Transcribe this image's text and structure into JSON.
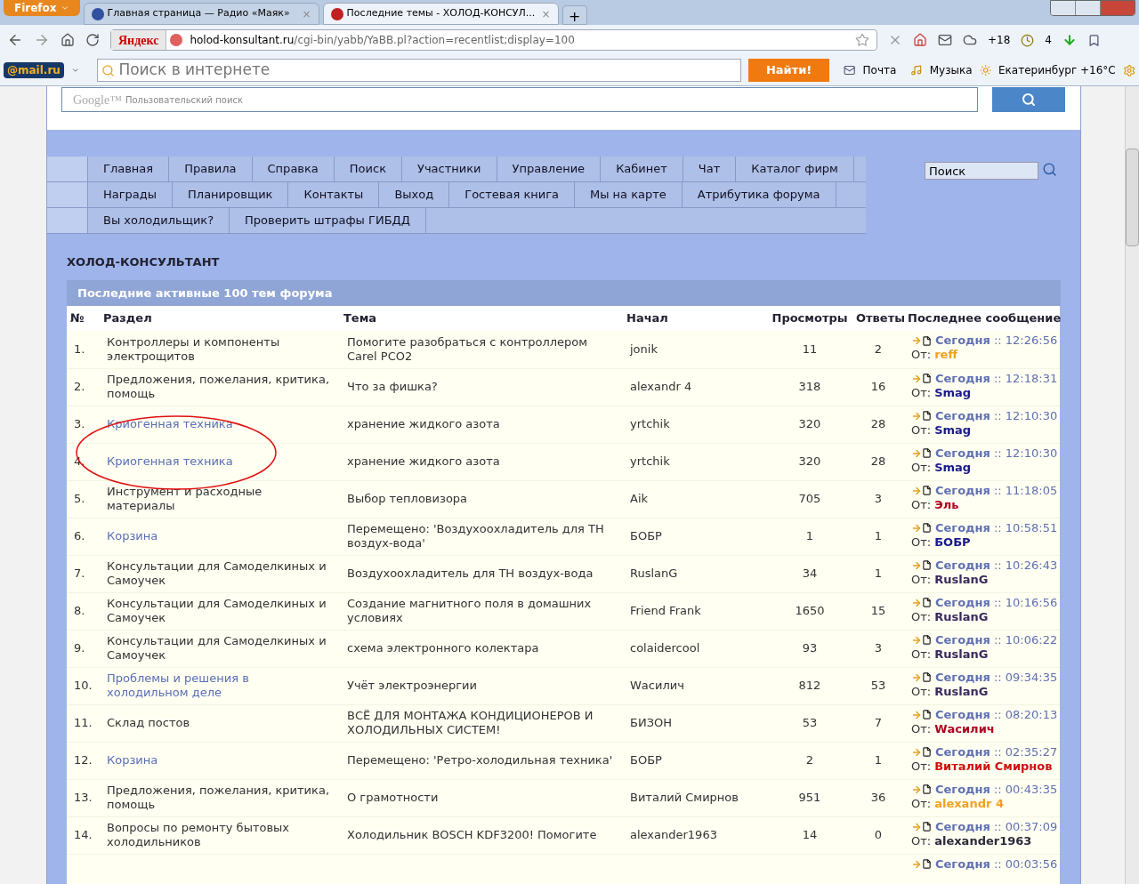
{
  "browser": {
    "menu_button": "Firefox",
    "tabs": [
      {
        "label": "Главная страница — Радио «Маяк»",
        "selected": false,
        "close": "×"
      },
      {
        "label": "Последние темы - ХОЛОД-КОНСУЛ...",
        "selected": true,
        "close": "×"
      }
    ],
    "new_tab": "+",
    "yandex": "Яндекс",
    "url": {
      "domain": "holod-konsultant.ru",
      "path": "/cgi-bin/yabb/YaBB.pl?action=recentlist;display=100"
    },
    "weather_temp": "+18",
    "counter": "4",
    "mail_logo": "@mail.ru",
    "search_placeholder": "Поиск в интернете",
    "search_button": "Найти!",
    "mail_link": "Почта",
    "music_link": "Музыка",
    "city_weather": "Екатеринбург +16°C"
  },
  "page": {
    "google_logo": "Google™",
    "google_placeholder": "Пользовательский поиск",
    "nav_rows": [
      [
        "Главная",
        "Правила",
        "Справка",
        "Поиск",
        "Участники",
        "Управление",
        "Кабинет",
        "Чат",
        "Каталог фирм"
      ],
      [
        "Награды",
        "Планировщик",
        "Контакты",
        "Выход",
        "Гостевая книга",
        "Мы на карте",
        "Атрибутика форума"
      ],
      [
        "Вы холодильщик?",
        "Проверить штрафы ГИБДД"
      ]
    ],
    "nav_search": "Поиск",
    "forum_title": "ХОЛОД-КОНСУЛЬТАНТ",
    "table_title": "Последние активные 100 тем форума",
    "columns": [
      "№",
      "Раздел",
      "Тема",
      "Начал",
      "Просмотры",
      "Ответы",
      "Последнее сообщение"
    ],
    "rows": [
      {
        "num": "1.",
        "section": {
          "text": "Контроллеры и компоненты электрощитов",
          "color": "#333333"
        },
        "topic": "Помогите разобраться с контроллером Carel PCO2",
        "starter": "jonik",
        "views": "11",
        "replies": "2",
        "last": {
          "day": "Сегодня",
          "time": ":: 12:26:56",
          "from_label": "От:",
          "from": "reff",
          "color": "#f0a020"
        }
      },
      {
        "num": "2.",
        "section": {
          "text": "Предложения, пожелания, критика, помощь",
          "color": "#333333"
        },
        "topic": "Что за фишка?",
        "starter": "alexandr 4",
        "views": "318",
        "replies": "16",
        "last": {
          "day": "Сегодня",
          "time": ":: 12:18:31",
          "from_label": "От:",
          "from": "Smag",
          "color": "#1a1a8a"
        }
      },
      {
        "num": "3.",
        "section": {
          "text": "Криогенная техника",
          "color": "#5a6fb5"
        },
        "topic": "хранение жидкого азота",
        "starter": "yrtchik",
        "views": "320",
        "replies": "28",
        "last": {
          "day": "Сегодня",
          "time": ":: 12:10:30",
          "from_label": "От:",
          "from": "Smag",
          "color": "#1a1a8a"
        }
      },
      {
        "num": "4.",
        "section": {
          "text": "Криогенная техника",
          "color": "#5a6fb5"
        },
        "topic": "хранение жидкого азота",
        "starter": "yrtchik",
        "views": "320",
        "replies": "28",
        "last": {
          "day": "Сегодня",
          "time": ":: 12:10:30",
          "from_label": "От:",
          "from": "Smag",
          "color": "#1a1a8a"
        }
      },
      {
        "num": "5.",
        "section": {
          "text": "Инструмент и расходные материалы",
          "color": "#333333"
        },
        "topic": "Выбор тепловизора",
        "starter": "Aik",
        "views": "705",
        "replies": "3",
        "last": {
          "day": "Сегодня",
          "time": ":: 11:18:05",
          "from_label": "От:",
          "from": "Эль",
          "color": "#b00020"
        }
      },
      {
        "num": "6.",
        "section": {
          "text": "Корзина",
          "color": "#5a6fb5"
        },
        "topic": "Перемещено: 'Воздухоохладитель для ТН воздух-вода'",
        "starter": "БОБР",
        "views": "1",
        "replies": "1",
        "last": {
          "day": "Сегодня",
          "time": ":: 10:58:51",
          "from_label": "От:",
          "from": "БОБР",
          "color": "#1a1a8a"
        }
      },
      {
        "num": "7.",
        "section": {
          "text": "Консультации для Самоделкиных и Самоучек",
          "color": "#333333"
        },
        "topic": "Воздухоохладитель для ТН воздух-вода",
        "starter": "RuslanG",
        "views": "34",
        "replies": "1",
        "last": {
          "day": "Сегодня",
          "time": ":: 10:26:43",
          "from_label": "От:",
          "from": "RuslanG",
          "color": "#3a2a5a"
        }
      },
      {
        "num": "8.",
        "section": {
          "text": "Консультации для Самоделкиных и Самоучек",
          "color": "#333333"
        },
        "topic": "Создание магнитного поля в домашних условиях",
        "starter": "Friend Frank",
        "views": "1650",
        "replies": "15",
        "last": {
          "day": "Сегодня",
          "time": ":: 10:16:56",
          "from_label": "От:",
          "from": "RuslanG",
          "color": "#3a2a5a"
        }
      },
      {
        "num": "9.",
        "section": {
          "text": "Консультации для Самоделкиных и Самоучек",
          "color": "#333333"
        },
        "topic": "схема электронного колектара",
        "starter": "colaidercool",
        "views": "93",
        "replies": "3",
        "last": {
          "day": "Сегодня",
          "time": ":: 10:06:22",
          "from_label": "От:",
          "from": "RuslanG",
          "color": "#3a2a5a"
        }
      },
      {
        "num": "10.",
        "section": {
          "text": "Проблемы и решения в холодильном деле",
          "color": "#5a6fb5"
        },
        "topic": "Учёт электроэнергии",
        "starter": "Wасилич",
        "views": "812",
        "replies": "53",
        "last": {
          "day": "Сегодня",
          "time": ":: 09:34:35",
          "from_label": "От:",
          "from": "RuslanG",
          "color": "#3a2a5a"
        }
      },
      {
        "num": "11.",
        "section": {
          "text": "Склад постов",
          "color": "#333333"
        },
        "topic": "ВСЁ ДЛЯ МОНТАЖА КОНДИЦИОНЕРОВ И ХОЛОДИЛЬНЫХ СИСТЕМ!",
        "starter": "БИЗОН",
        "views": "53",
        "replies": "7",
        "last": {
          "day": "Сегодня",
          "time": ":: 08:20:13",
          "from_label": "От:",
          "from": "Wасилич",
          "color": "#b00020"
        }
      },
      {
        "num": "12.",
        "section": {
          "text": "Корзина",
          "color": "#5a6fb5"
        },
        "topic": "Перемещено: 'Ретро-холодильная техника'",
        "starter": "БОБР",
        "views": "2",
        "replies": "1",
        "last": {
          "day": "Сегодня",
          "time": ":: 02:35:27",
          "from_label": "От:",
          "from": "Виталий Смирнов",
          "color": "#d01010"
        }
      },
      {
        "num": "13.",
        "section": {
          "text": "Предложения, пожелания, критика, помощь",
          "color": "#333333"
        },
        "topic": "О грамотности",
        "starter": "Виталий Смирнов",
        "views": "951",
        "replies": "36",
        "last": {
          "day": "Сегодня",
          "time": ":: 00:43:35",
          "from_label": "От:",
          "from": "alexandr 4",
          "color": "#f0a020"
        }
      },
      {
        "num": "14.",
        "section": {
          "text": "Вопросы по ремонту бытовых холодильников",
          "color": "#333333"
        },
        "topic": "Холодильник BOSCH KDF3200! Помогите",
        "starter": "alexander1963",
        "views": "14",
        "replies": "0",
        "last": {
          "day": "Сегодня",
          "time": ":: 00:37:09",
          "from_label": "От:",
          "from": "alexander1963",
          "color": "#2a2a3a"
        }
      },
      {
        "last": {
          "day": "Сегодня",
          "time": ":: 00:03:56"
        }
      }
    ]
  }
}
